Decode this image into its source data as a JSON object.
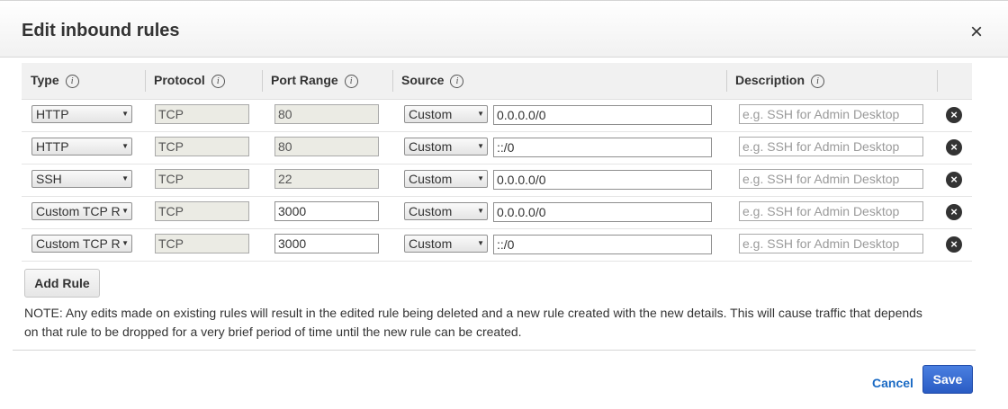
{
  "dialog": {
    "title": "Edit inbound rules",
    "close_label": "×"
  },
  "table": {
    "headers": {
      "type": "Type",
      "protocol": "Protocol",
      "port_range": "Port Range",
      "source": "Source",
      "description": "Description"
    },
    "info_glyph": "i",
    "delete_glyph": "×",
    "dropdown_arrow": "▼",
    "description_placeholder": "e.g. SSH for Admin Desktop",
    "rows": [
      {
        "type": "HTTP",
        "protocol": "TCP",
        "port": "80",
        "source_mode": "Custom",
        "source": "0.0.0.0/0",
        "port_editable": false
      },
      {
        "type": "HTTP",
        "protocol": "TCP",
        "port": "80",
        "source_mode": "Custom",
        "source": "::/0",
        "port_editable": false
      },
      {
        "type": "SSH",
        "protocol": "TCP",
        "port": "22",
        "source_mode": "Custom",
        "source": "0.0.0.0/0",
        "port_editable": false
      },
      {
        "type": "Custom TCP R",
        "protocol": "TCP",
        "port": "3000",
        "source_mode": "Custom",
        "source": "0.0.0.0/0",
        "port_editable": true
      },
      {
        "type": "Custom TCP R",
        "protocol": "TCP",
        "port": "3000",
        "source_mode": "Custom",
        "source": "::/0",
        "port_editable": true
      }
    ]
  },
  "add_rule_label": "Add Rule",
  "note_text": "NOTE: Any edits made on existing rules will result in the edited rule being deleted and a new rule created with the new details. This will cause traffic that depends on that rule to be dropped for a very brief period of time until the new rule can be created.",
  "footer": {
    "cancel_label": "Cancel",
    "save_label": "Save"
  },
  "colors": {
    "save_button": "#2a5cc4",
    "cancel_link": "#1a6ac4",
    "header_bg": "#f1f1f1"
  }
}
